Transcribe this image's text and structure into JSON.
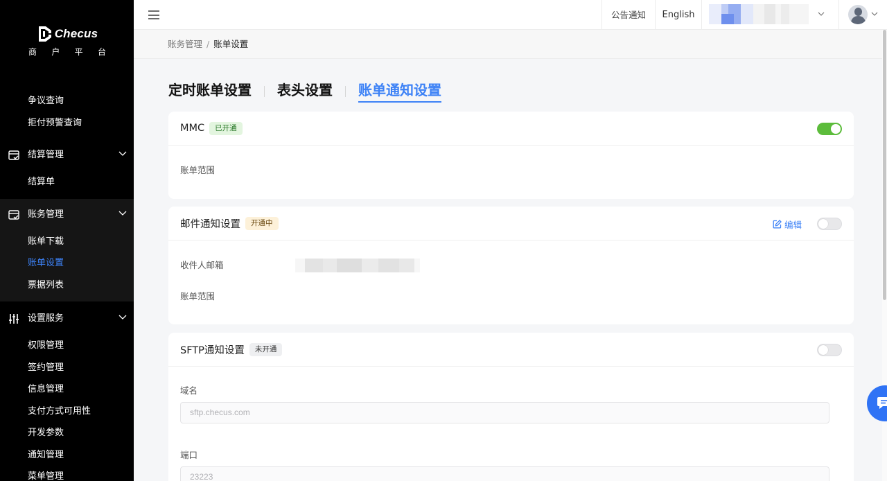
{
  "brand": {
    "name": "Checus",
    "subtitle": [
      "商",
      "户",
      "平",
      "台"
    ]
  },
  "sidebar": {
    "top_items": [
      {
        "label": "争议查询"
      },
      {
        "label": "拒付预警查询"
      }
    ],
    "groups": [
      {
        "label": "结算管理",
        "icon": "settlement-icon",
        "items": [
          {
            "label": "结算单"
          }
        ]
      },
      {
        "label": "账务管理",
        "icon": "accounting-icon",
        "items": [
          {
            "label": "账单下载"
          },
          {
            "label": "账单设置",
            "active": true
          },
          {
            "label": "票据列表"
          }
        ]
      },
      {
        "label": "设置服务",
        "icon": "sliders-icon",
        "items": [
          {
            "label": "权限管理"
          },
          {
            "label": "签约管理"
          },
          {
            "label": "信息管理"
          },
          {
            "label": "支付方式可用性"
          },
          {
            "label": "开发参数"
          },
          {
            "label": "通知管理"
          },
          {
            "label": "菜单管理"
          }
        ]
      }
    ]
  },
  "header": {
    "notice": "公告通知",
    "language": "English"
  },
  "breadcrumb": {
    "parent": "账务管理",
    "separator": "/",
    "current": "账单设置"
  },
  "tabs": [
    {
      "label": "定时账单设置",
      "active": false
    },
    {
      "label": "表头设置",
      "active": false
    },
    {
      "label": "账单通知设置",
      "active": true
    }
  ],
  "cards": {
    "mmc": {
      "title": "MMC",
      "badge": "已开通",
      "enabled": true,
      "fields": {
        "scope_label": "账单范围"
      }
    },
    "email": {
      "title": "邮件通知设置",
      "badge": "开通中",
      "edit_label": "编辑",
      "enabled": false,
      "fields": {
        "recipient_label": "收件人邮箱",
        "scope_label": "账单范围"
      }
    },
    "sftp": {
      "title": "SFTP通知设置",
      "badge": "未开通",
      "enabled": false,
      "fields": {
        "domain_label": "域名",
        "domain_placeholder": "sftp.checus.com",
        "port_label": "端口",
        "port_placeholder": "23223"
      }
    }
  },
  "colors": {
    "accent": "#3d82f6",
    "toggle_on": "#5cbc3b",
    "sidebar_bg": "#000000"
  }
}
